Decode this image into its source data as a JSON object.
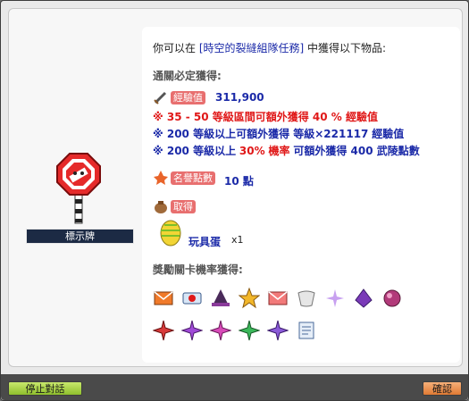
{
  "intro": {
    "pre": "你可以在",
    "link": "[時空的裂縫組隊任務]",
    "post": "中獲得以下物品:"
  },
  "clear_section": {
    "title": "通關必定獲得:"
  },
  "exp": {
    "label": "經驗值",
    "value": "311,900"
  },
  "lines": {
    "l1": {
      "text": "※ 35 - 50 等級區間可額外獲得 40 % 經驗值"
    },
    "l2_prefix": "※ 200 等級以上可額外獲得 等級×221117",
    "l2_suffix": "經驗值",
    "l3_pre": "※ 200 等級以上",
    "l3_pct": "30%",
    "l3_mid": "機率",
    "l3_post": "可額外獲得 400 武陵點數"
  },
  "honor": {
    "label": "名譽點數",
    "value": "10 點"
  },
  "obtain": {
    "label": "取得"
  },
  "toy": {
    "name": "玩具蛋",
    "qty": "x1"
  },
  "bonus_section": {
    "title": "獎勵關卡機率獲得:"
  },
  "npc": {
    "name": "標示牌"
  },
  "buttons": {
    "end": "停止對話",
    "ok": "確認"
  },
  "colors": {
    "accent_blue": "#1b2aa8",
    "accent_red": "#e01818",
    "name_bg": "#1c2a44"
  }
}
